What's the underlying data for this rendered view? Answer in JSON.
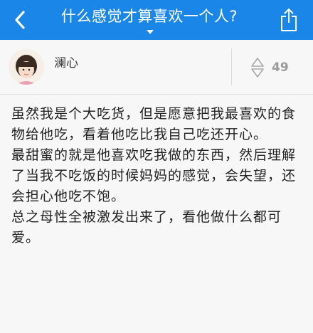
{
  "header": {
    "title": "什么感觉才算喜欢一个人?",
    "back_icon": "chevron-left-icon",
    "share_icon": "share-icon",
    "dropdown_icon": "caret-down-icon",
    "bg_color": "#1a86e8"
  },
  "author": {
    "name": "澜心"
  },
  "vote": {
    "count": "49"
  },
  "answer": {
    "paragraphs": [
      "虽然我是个大吃货，但是愿意把我最喜欢的食物给他吃，看着他吃比我自己吃还开心。",
      "最甜蜜的就是他喜欢吃我做的东西，然后理解了当我不吃饭的时候妈妈的感觉，会失望，还会担心他吃不饱。",
      "总之母性全被激发出来了，看他做什么都可爱。"
    ]
  }
}
